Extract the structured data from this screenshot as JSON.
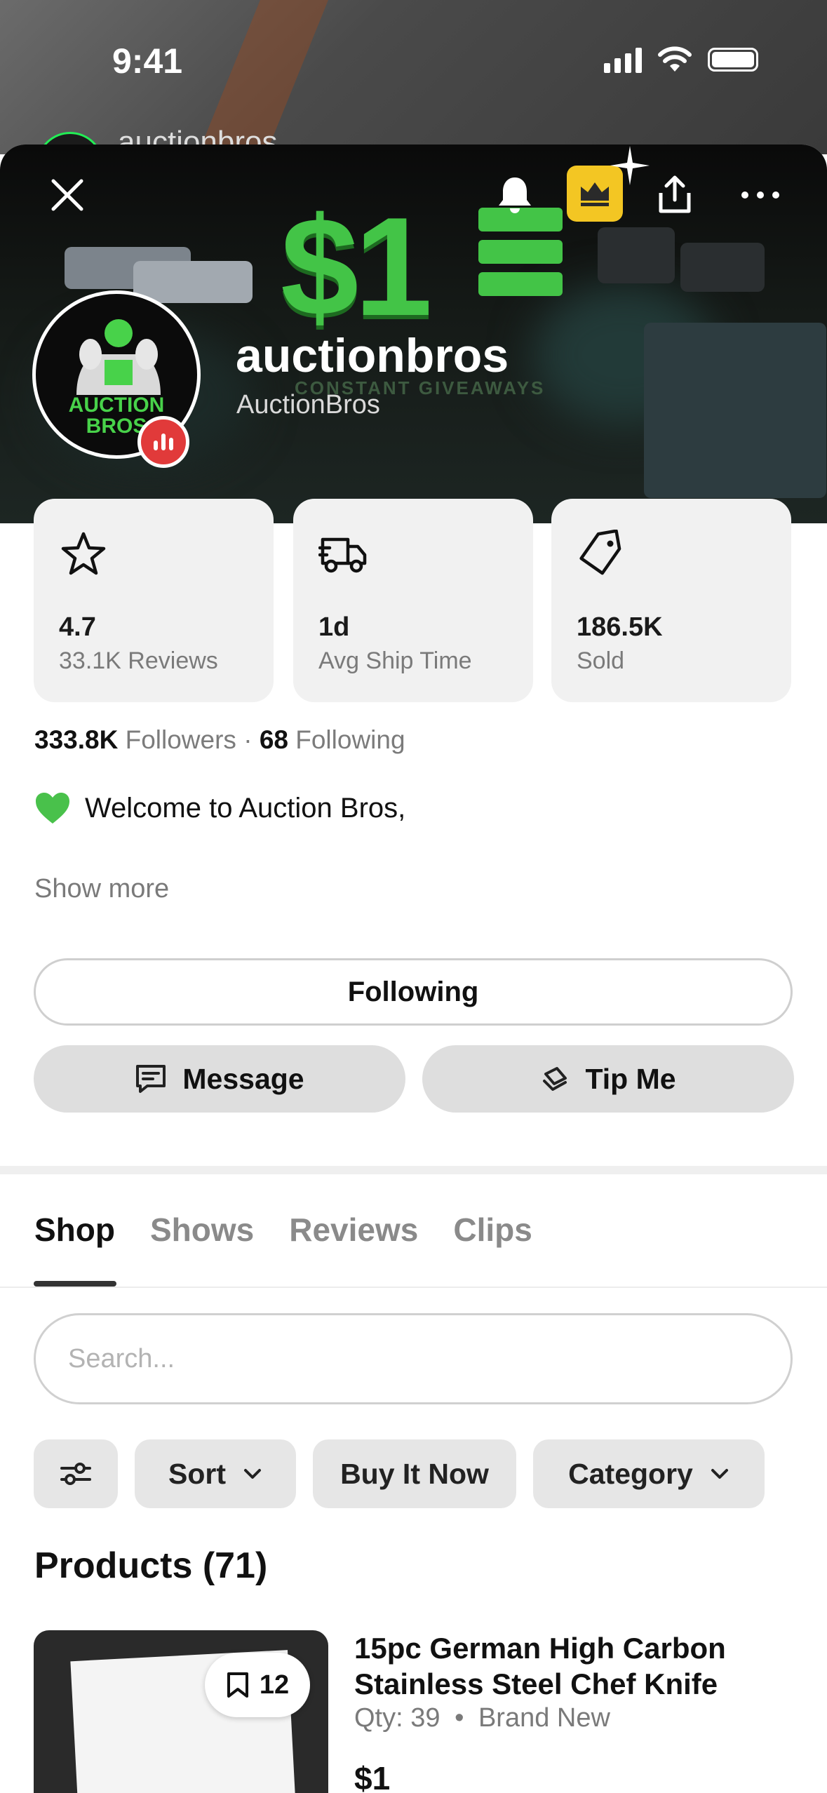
{
  "status_bar": {
    "time": "9:41"
  },
  "background_app": {
    "title": "auctionbros"
  },
  "banner": {
    "headline": "$1",
    "subtext": "CONSTANT GIVEAWAYS"
  },
  "profile": {
    "username": "auctionbros",
    "display_name": "AuctionBros",
    "avatar_text_line1": "AUCTION",
    "avatar_text_line2": "BROS"
  },
  "stats": [
    {
      "icon": "star-icon",
      "value": "4.7",
      "label": "33.1K Reviews"
    },
    {
      "icon": "truck-icon",
      "value": "1d",
      "label": "Avg Ship Time"
    },
    {
      "icon": "tag-icon",
      "value": "186.5K",
      "label": "Sold"
    }
  ],
  "social": {
    "followers_count": "333.8K",
    "followers_label": "Followers",
    "separator": "·",
    "following_count": "68",
    "following_label": "Following"
  },
  "bio": {
    "text": "Welcome to Auction Bros,",
    "show_more": "Show more"
  },
  "actions": {
    "following": "Following",
    "message": "Message",
    "tip": "Tip Me"
  },
  "tabs": [
    {
      "label": "Shop",
      "active": true
    },
    {
      "label": "Shows",
      "active": false
    },
    {
      "label": "Reviews",
      "active": false
    },
    {
      "label": "Clips",
      "active": false
    }
  ],
  "search": {
    "placeholder": "Search..."
  },
  "filters": {
    "sort": "Sort",
    "buy_it_now": "Buy It Now",
    "category": "Category"
  },
  "products": {
    "title": "Products (71)",
    "items": [
      {
        "title": "15pc German High Carbon Stainless Steel Chef Knife",
        "qty": "Qty: 39",
        "dot": "•",
        "condition": "Brand New",
        "price": "$1",
        "saves": "12"
      }
    ]
  },
  "colors": {
    "accent_green": "#43c447",
    "live_red": "#e13a3a",
    "crown_yellow": "#f3c623"
  }
}
